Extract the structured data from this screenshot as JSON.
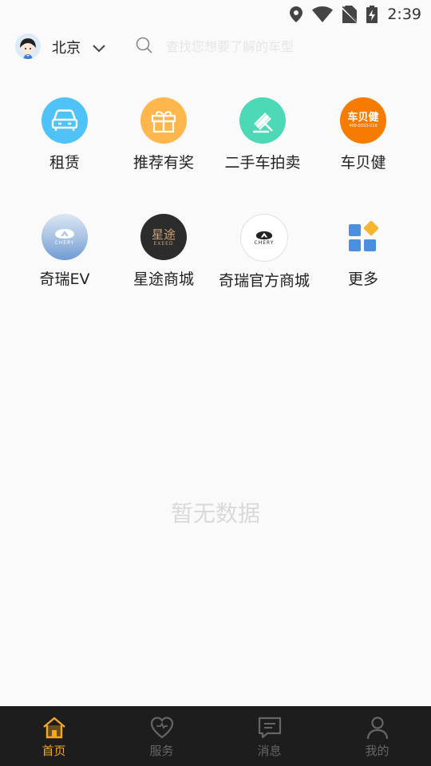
{
  "status_bar": {
    "time": "2:39"
  },
  "header": {
    "city": "北京",
    "search_placeholder": "查找您想要了解的车型"
  },
  "grid": [
    {
      "label": "租赁",
      "icon": "car-icon",
      "color": "#4fc3f7"
    },
    {
      "label": "推荐有奖",
      "icon": "gift-icon",
      "color": "#ffb74d"
    },
    {
      "label": "二手车拍卖",
      "icon": "gavel-icon",
      "color": "#4dd9b5"
    },
    {
      "label": "车贝健",
      "icon": "chebeijian-logo",
      "color": "#f57c00",
      "logo_text": "车贝健",
      "logo_sub": "400-0553-019"
    },
    {
      "label": "奇瑞EV",
      "icon": "chery-ev-logo",
      "color": "#7fa8d8",
      "logo_text": "CHERY"
    },
    {
      "label": "星途商城",
      "icon": "exeed-logo",
      "color": "#2c2c2c",
      "logo_text": "星途",
      "logo_sub": "EXEED"
    },
    {
      "label": "奇瑞官方商城",
      "icon": "chery-logo",
      "color": "#ffffff",
      "logo_text": "CHERY"
    },
    {
      "label": "更多",
      "icon": "more-apps-icon",
      "color": "#4a90e2"
    }
  ],
  "empty_state": {
    "text": "暂无数据"
  },
  "bottom_nav": [
    {
      "label": "首页",
      "icon": "home-icon",
      "active": true
    },
    {
      "label": "服务",
      "icon": "heart-icon",
      "active": false
    },
    {
      "label": "消息",
      "icon": "message-icon",
      "active": false
    },
    {
      "label": "我的",
      "icon": "user-icon",
      "active": false
    }
  ],
  "colors": {
    "accent": "#f5a623",
    "nav_bg": "#1d1d1d",
    "empty_text": "#d9d9d9"
  }
}
